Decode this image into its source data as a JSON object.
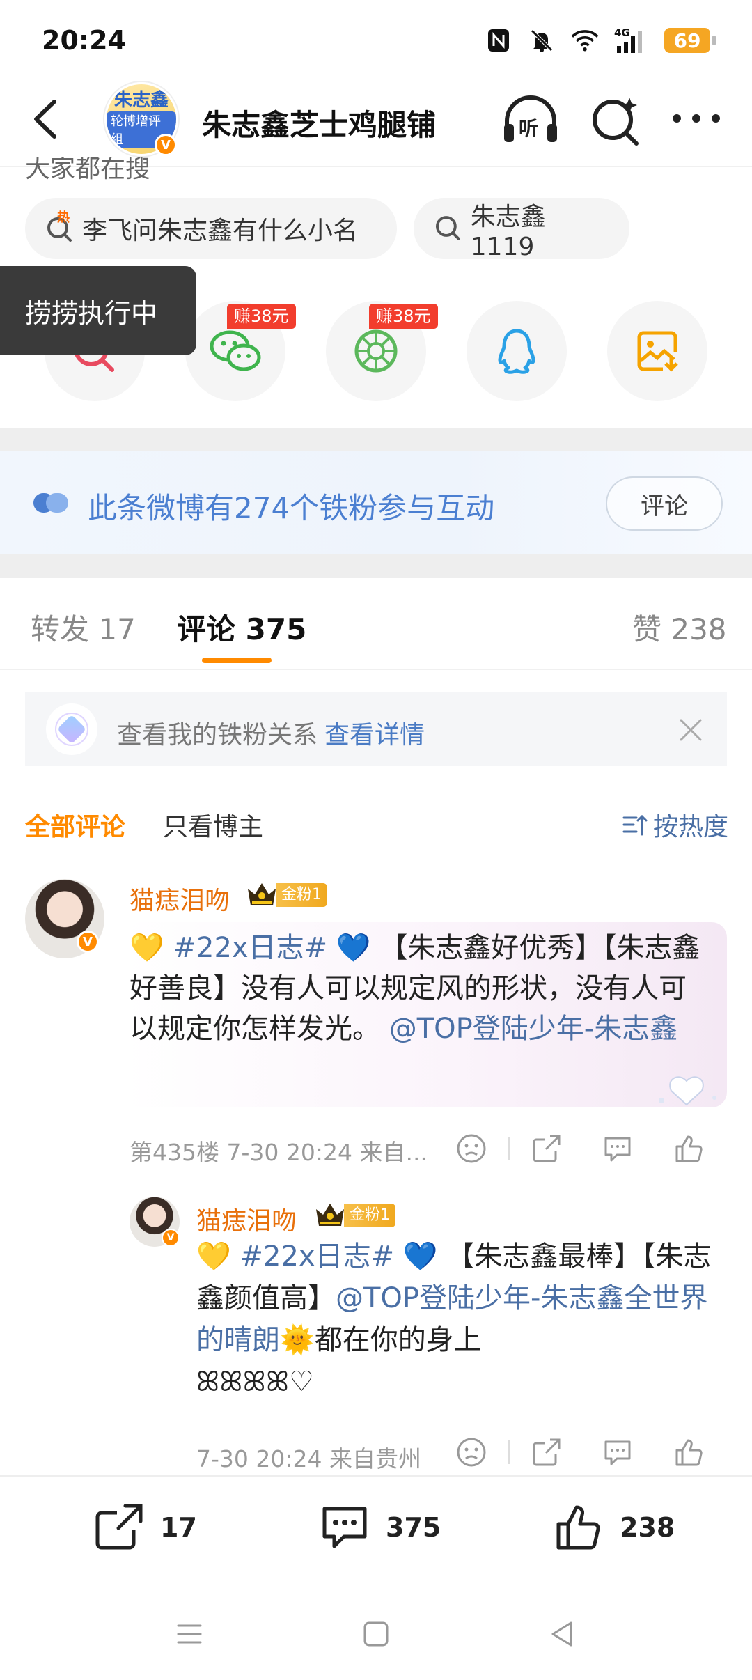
{
  "status_bar": {
    "time": "20:24",
    "network": "4G",
    "battery": "69",
    "icons": [
      "nfc-icon",
      "mute-icon",
      "wifi-icon",
      "signal-icon",
      "battery-icon"
    ]
  },
  "nav": {
    "title": "朱志鑫芝士鸡腿铺",
    "avatar_line1": "朱志鑫",
    "avatar_line2": "轮博增评组",
    "verified_mark": "V"
  },
  "trending": {
    "label": "大家都在搜",
    "chips": [
      "李飞问朱志鑫有什么小名",
      "朱志鑫1119"
    ],
    "hot_mark": "热"
  },
  "share_row": {
    "earn_labels": [
      "赚38元",
      "赚38元"
    ],
    "targets": [
      "search-share-icon",
      "wechat-icon",
      "moments-icon",
      "qq-icon",
      "save-image-icon"
    ]
  },
  "toast": {
    "text": "捞捞执行中"
  },
  "fans_card": {
    "text": "此条微博有274个铁粉参与互动",
    "button": "评论"
  },
  "tabs": [
    {
      "label": "转发 17"
    },
    {
      "label": "评论 375"
    },
    {
      "label": "赞 238"
    }
  ],
  "relation_banner": {
    "text": "查看我的铁粉关系",
    "link": "查看详情"
  },
  "filters": {
    "all": "全部评论",
    "owner_only": "只看博主",
    "sort": "按热度"
  },
  "comments": [
    {
      "user": "猫痣泪吻",
      "fan_badge": "金粉1",
      "parts": {
        "heart_yellow": "💛",
        "topic": "#22x日志#",
        "heart_blue": "💙",
        "body": " 【朱志鑫好优秀】【朱志鑫好善良】没有人可以规定风的形状，没有人可以规定你怎样发光。",
        "mention": "@TOP登陆少年-朱志鑫"
      },
      "meta": "第435楼  7-30 20:24  来自..."
    },
    {
      "user": "猫痣泪吻",
      "fan_badge": "金粉1",
      "parts": {
        "heart_yellow": "💛",
        "topic": "#22x日志#",
        "heart_blue": "💙",
        "body": " 【朱志鑫最棒】【朱志鑫颜值高】",
        "mention": "@TOP登陆少年-朱志鑫全世界的晴朗",
        "sun": "🌞",
        "tail": "都在你的身上",
        "deco": "ꕤꕤꕤꕤ♡"
      },
      "meta": "7-30 20:24  来自贵州"
    }
  ],
  "bottom_bar": {
    "repost": "17",
    "comment": "375",
    "like": "238"
  },
  "colors": {
    "accent": "#ff8a00",
    "link": "#4a6fa5",
    "username": "#e8700b",
    "earn_red": "#f23d2d"
  }
}
